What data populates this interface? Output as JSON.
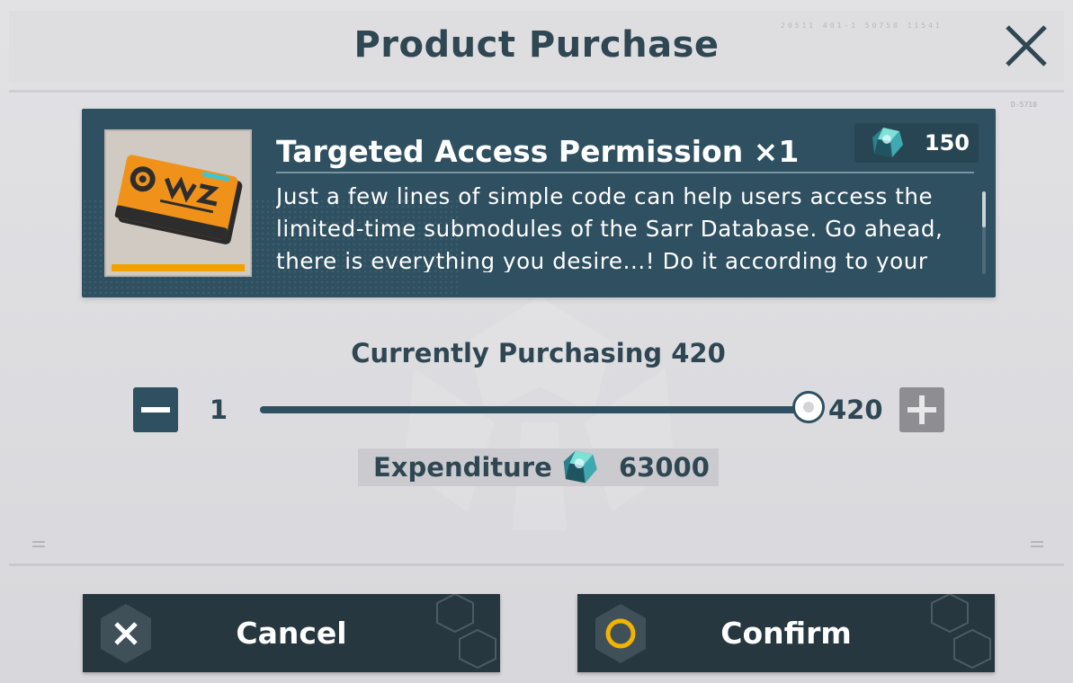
{
  "header": {
    "title": "Product Purchase",
    "code_text": "20511 401-1 50750 11541",
    "side_code": "D-5710"
  },
  "item": {
    "name": "Targeted Access Permission ×1",
    "price": "150",
    "description": "Just a few lines of simple code can help users access the limited-time submodules of the Sarr Database. Go ahead, there is everything you desire...! Do it according to your capabilities.",
    "rarity_color": "#f3a100"
  },
  "quantity": {
    "label": "Currently Purchasing 420",
    "min": "1",
    "max": "420",
    "current_fraction": 1.0
  },
  "expenditure": {
    "label": "Expenditure",
    "value": "63000"
  },
  "actions": {
    "cancel_label": "Cancel",
    "confirm_label": "Confirm"
  },
  "icons": {
    "close": "close-icon",
    "currency": "crystal-gem-icon",
    "minus": "minus-icon",
    "plus": "plus-icon",
    "cancel": "x-hex-icon",
    "confirm": "circle-hex-icon"
  },
  "colors": {
    "primary": "#2f5061",
    "text_dark": "#2f4753",
    "confirm_accent": "#f3b300"
  }
}
